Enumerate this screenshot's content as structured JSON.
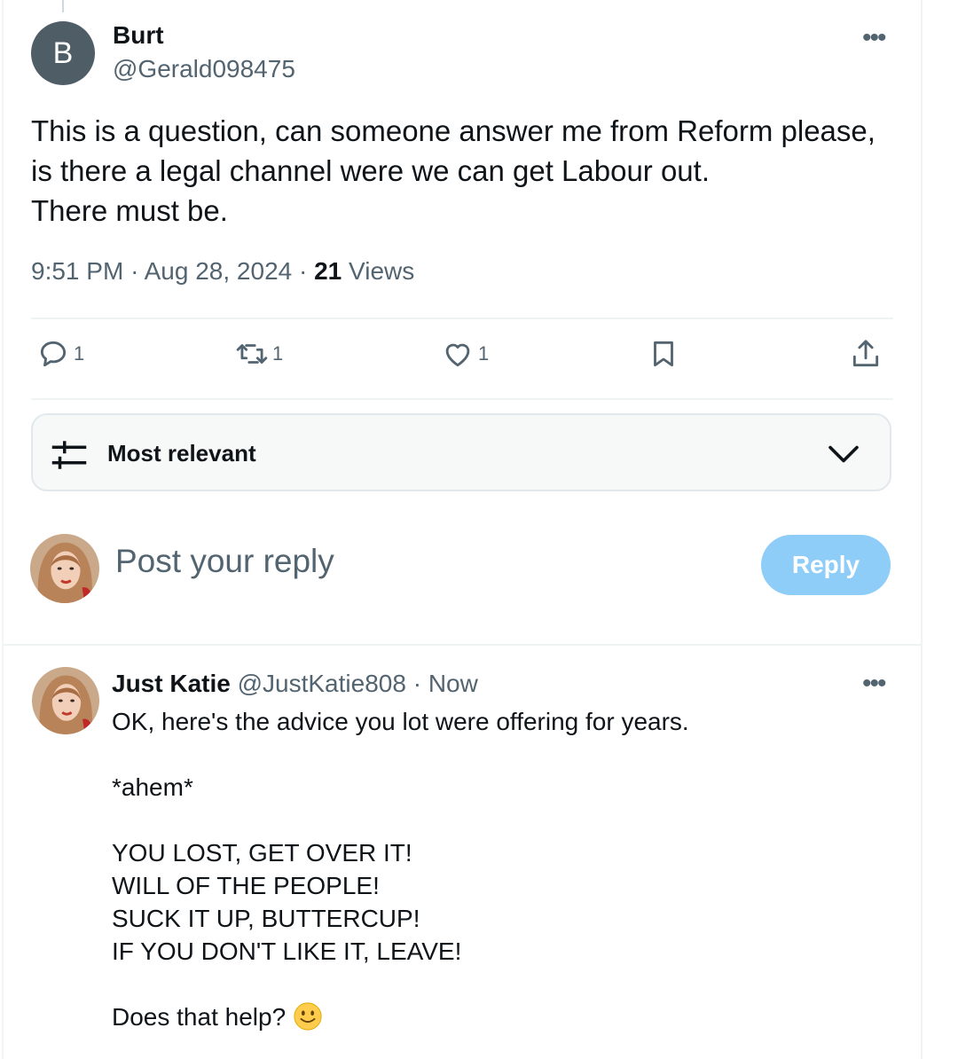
{
  "post": {
    "avatar_letter": "B",
    "author_name": "Burt",
    "author_handle": "@Gerald098475",
    "more_label": "•••",
    "text_lines": [
      "This is a question, can someone answer me from Reform please,",
      "is there a legal channel were we can get Labour out.",
      "There must be."
    ],
    "time": "9:51 PM",
    "date": "Aug 28, 2024",
    "separator": "·",
    "views_count": "21",
    "views_label": "Views"
  },
  "actions": {
    "reply_count": "1",
    "repost_count": "1",
    "like_count": "1",
    "icons": [
      "reply-icon",
      "repost-icon",
      "like-icon",
      "bookmark-icon",
      "share-icon"
    ]
  },
  "sort": {
    "label": "Most relevant",
    "icon": "sliders-icon"
  },
  "composer": {
    "placeholder": "Post your reply",
    "button_label": "Reply"
  },
  "reply": {
    "author_name": "Just Katie",
    "author_handle": "@JustKatie808",
    "separator": "·",
    "time": "Now",
    "more_label": "•••",
    "line1": "OK, here's the advice you lot were offering for years.",
    "line2": "*ahem*",
    "shout_lines": [
      "YOU LOST, GET OVER IT!",
      "WILL OF THE PEOPLE!",
      "SUCK IT UP, BUTTERCUP!",
      "IF YOU DON'T LIKE IT, LEAVE!"
    ],
    "closing": "Does that help?",
    "emoji": "slightly-smiling-face-icon"
  },
  "colors": {
    "text": "#0f1419",
    "secondary": "#536471",
    "reply_button": "#8ecdf8",
    "divider": "#eff3f4"
  }
}
